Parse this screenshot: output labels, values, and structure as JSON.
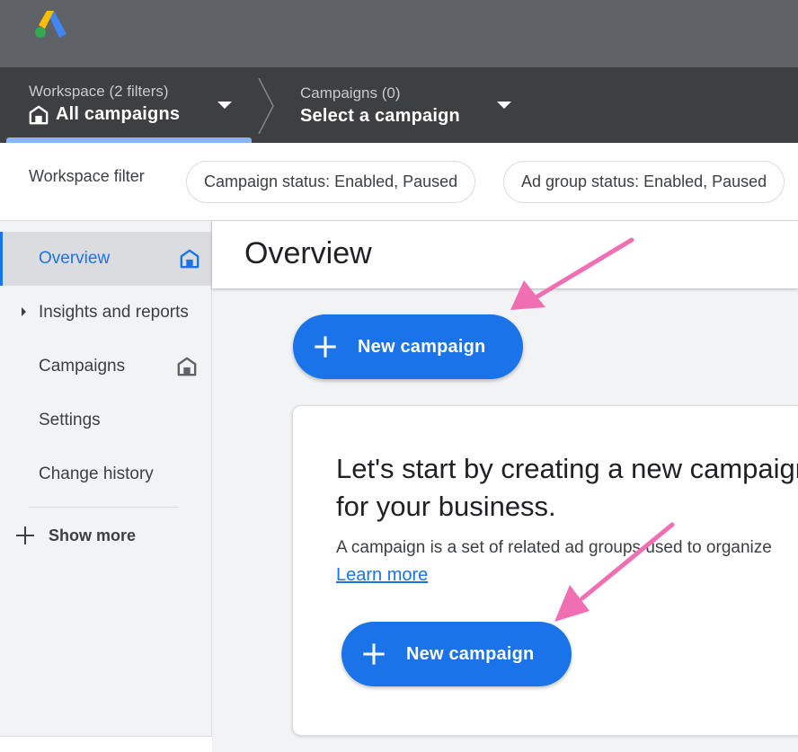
{
  "app": {
    "logo_icon": "google-ads-logo"
  },
  "workspace": {
    "subtitle": "Workspace (2 filters)",
    "title": "All campaigns"
  },
  "campaigns_selector": {
    "subtitle": "Campaigns (0)",
    "title": "Select a campaign"
  },
  "filter_bar": {
    "label": "Workspace filter",
    "chips": [
      "Campaign status: Enabled, Paused",
      "Ad group status: Enabled, Paused"
    ]
  },
  "sidebar": {
    "items": [
      {
        "label": "Overview",
        "active": true
      },
      {
        "label": "Insights and reports"
      },
      {
        "label": "Campaigns"
      },
      {
        "label": "Settings"
      },
      {
        "label": "Change history"
      }
    ],
    "show_more": "Show more"
  },
  "main": {
    "title": "Overview",
    "new_campaign_label": "New campaign",
    "card": {
      "title": "Let's start by creating a new campaign for your business.",
      "description": "A campaign is a set of related ad groups used to organize",
      "learn_more": "Learn more",
      "button_label": "New campaign"
    }
  },
  "colors": {
    "accent": "#1a73e8",
    "arrow": "#f06fb3",
    "topbar": "#5f6368",
    "navbar": "#3c4043"
  }
}
